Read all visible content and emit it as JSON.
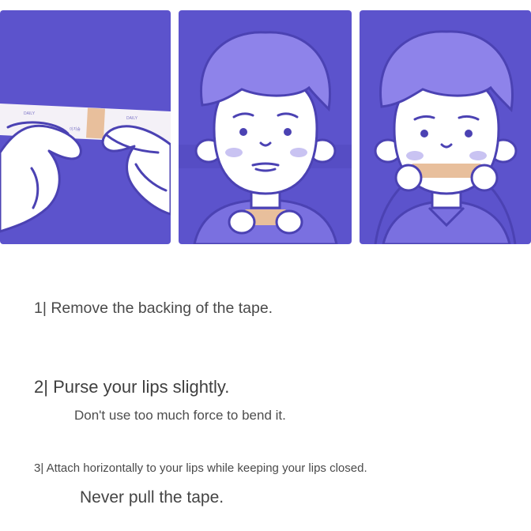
{
  "colors": {
    "panel_bg": "#5c53cc",
    "hair": "#8e83ea",
    "skin": "#ffffff",
    "outline": "#4b42b3",
    "tape": "#e8bf9c",
    "blush": "#c9c3f2"
  },
  "panels": [
    {
      "tape_text": [
        "DAILY",
        "이지숨",
        "DAILY"
      ]
    },
    {},
    {}
  ],
  "steps": [
    {
      "title": "1| Remove the backing of the tape."
    },
    {
      "title": "2| Purse your lips slightly.",
      "note": "Don't use too much force to bend it."
    },
    {
      "title": "3| Attach horizontally to your lips while keeping your lips closed.",
      "note": "Never pull the tape."
    }
  ]
}
